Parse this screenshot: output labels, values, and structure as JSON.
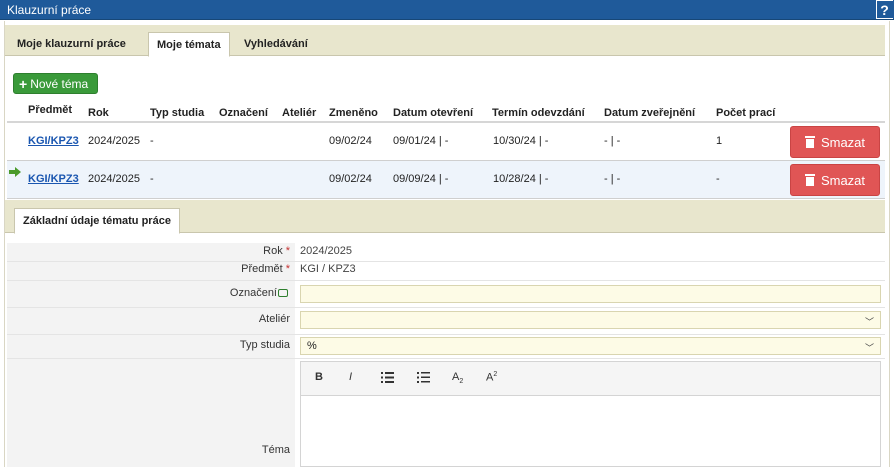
{
  "window": {
    "title": "Klauzurní práce",
    "help": "?"
  },
  "tabs": [
    {
      "label": "Moje klauzurní práce"
    },
    {
      "label": "Moje témata"
    },
    {
      "label": "Vyhledávání"
    }
  ],
  "new_button": {
    "label": "Nové téma",
    "icon": "plus-icon"
  },
  "table": {
    "headers": [
      "Předmět",
      "Rok",
      "Typ studia",
      "Označení",
      "Ateliér",
      "Zmeněno",
      "Datum otevření",
      "Termín odevzdání",
      "Datum zveřejnění",
      "Počet prací"
    ],
    "rows": [
      {
        "predmet": "KGI/KPZ3",
        "rok": "2024/2025",
        "typ": "-",
        "oznaceni": "",
        "atelier": "",
        "zmeneno": "09/02/24",
        "otevreni": "09/01/24 | -",
        "odevzdani": "10/30/24 | -",
        "zverejneni": "- | -",
        "pocet": "1",
        "delete": "Smazat"
      },
      {
        "predmet": "KGI/KPZ3",
        "rok": "2024/2025",
        "typ": "-",
        "oznaceni": "",
        "atelier": "",
        "zmeneno": "09/02/24",
        "otevreni": "09/09/24 | -",
        "odevzdani": "10/28/24 | -",
        "zverejneni": "- | -",
        "pocet": "-",
        "delete": "Smazat"
      }
    ]
  },
  "subtab": {
    "label": "Základní údaje tématu práce"
  },
  "form": {
    "rok_label": "Rok",
    "rok_value": "2024/2025",
    "predmet_label": "Předmět",
    "predmet_value": "KGI / KPZ3",
    "oznaceni_label": "Označení",
    "atelier_label": "Ateliér",
    "typ_label": "Typ studia",
    "typ_value": "%",
    "tema_label": "Téma",
    "req": "*"
  },
  "editor_toolbar": {
    "bold": "B",
    "italic": "I",
    "sub": "A",
    "sub_mark": "2",
    "sup": "A",
    "sup_mark": "2"
  },
  "colors": {
    "titlebar": "#1f5a9a",
    "tabbar": "#e8e6cd",
    "new_button": "#3a9a3a",
    "delete_button": "#e05555",
    "link": "#1a56b0"
  }
}
